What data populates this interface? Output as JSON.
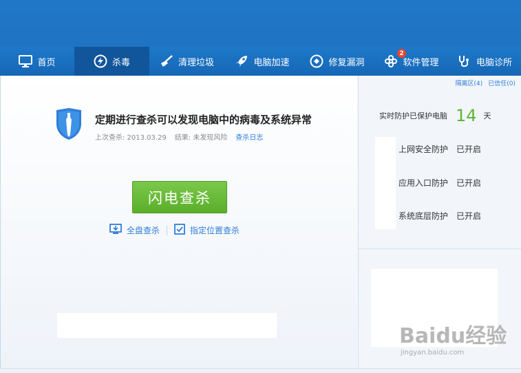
{
  "nav": {
    "tabs": [
      {
        "label": "首页",
        "icon": "monitor-icon",
        "active": false
      },
      {
        "label": "杀毒",
        "icon": "lightning-icon",
        "active": true
      },
      {
        "label": "清理垃圾",
        "icon": "broom-icon",
        "active": false
      },
      {
        "label": "电脑加速",
        "icon": "rocket-icon",
        "active": false
      },
      {
        "label": "修复漏洞",
        "icon": "patch-icon",
        "active": false
      },
      {
        "label": "软件管理",
        "icon": "apps-icon",
        "active": false,
        "badge": "2"
      },
      {
        "label": "电脑诊所",
        "icon": "stethoscope-icon",
        "active": false
      }
    ]
  },
  "scan": {
    "headline": "定期进行查杀可以发现电脑中的病毒及系统异常",
    "last_scan": "上次查杀: 2013.03.29",
    "result": "结果: 未发现风险",
    "log_link": "查杀日志",
    "flash_button": "闪电查杀",
    "full_scan": "全盘查杀",
    "custom_scan": "指定位置查杀"
  },
  "right": {
    "quarantine": "隔离区(4)",
    "trusted": "已信任(0)",
    "protect_prefix": "实时防护已保护电脑",
    "protect_days": "14",
    "protect_unit": "天",
    "items": [
      {
        "name": "上网安全防护",
        "status": "已开启"
      },
      {
        "name": "应用入口防护",
        "status": "已开启"
      },
      {
        "name": "系统底层防护",
        "status": "已开启"
      }
    ]
  },
  "watermark": {
    "brand": "Baidu经验",
    "url": "jingyan.baidu.com"
  },
  "colors": {
    "nav_bg": "#1e78c9",
    "nav_active": "#11569b",
    "flash_button": "#6abd3a",
    "link": "#2f7ed8",
    "days": "#5cb531"
  }
}
